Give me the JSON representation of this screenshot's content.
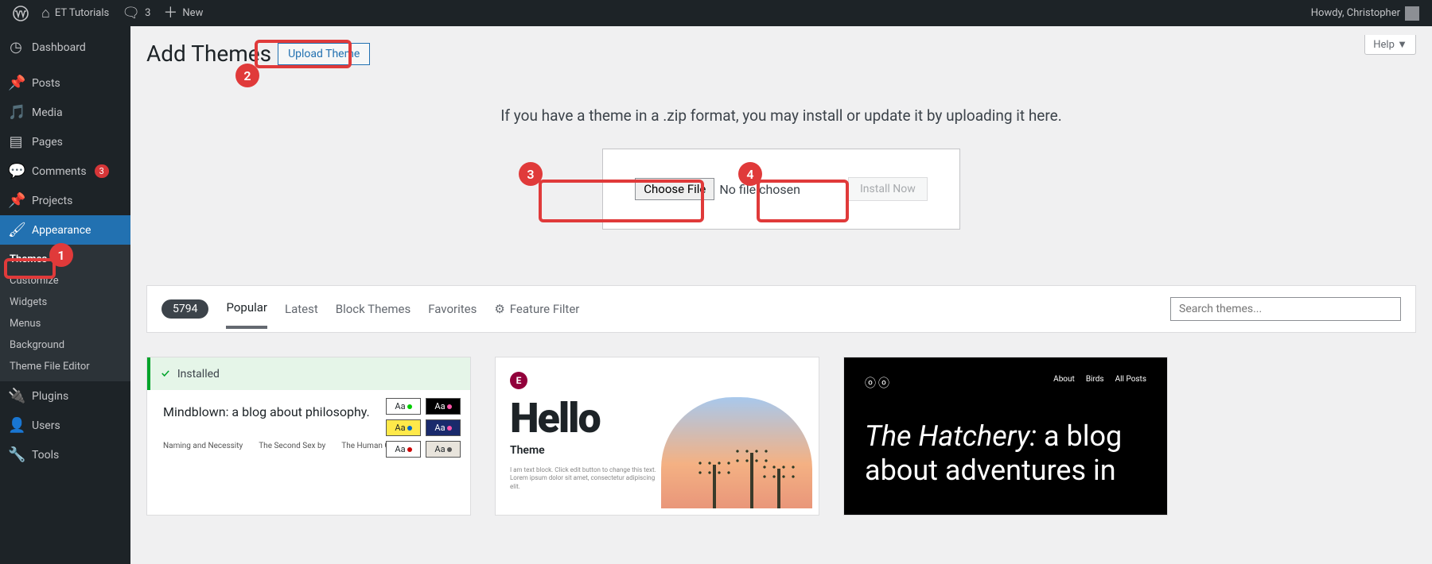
{
  "adminbar": {
    "site_name": "ET Tutorials",
    "comments_count": "3",
    "new_label": "New",
    "howdy": "Howdy, Christopher"
  },
  "sidebar": {
    "dashboard": "Dashboard",
    "posts": "Posts",
    "media": "Media",
    "pages": "Pages",
    "comments": "Comments",
    "comments_badge": "3",
    "projects": "Projects",
    "appearance": "Appearance",
    "appearance_sub": {
      "themes": "Themes",
      "customize": "Customize",
      "widgets": "Widgets",
      "menus": "Menus",
      "background": "Background",
      "editor": "Theme File Editor"
    },
    "plugins": "Plugins",
    "users": "Users",
    "tools": "Tools"
  },
  "page": {
    "title": "Add Themes",
    "upload_btn": "Upload Theme",
    "help": "Help",
    "upload_instruction": "If you have a theme in a .zip format, you may install or update it by uploading it here.",
    "choose_file": "Choose File",
    "no_file": "No file chosen",
    "install_now": "Install Now"
  },
  "filters": {
    "count": "5794",
    "popular": "Popular",
    "latest": "Latest",
    "block": "Block Themes",
    "favorites": "Favorites",
    "feature_filter": "Feature Filter",
    "search_placeholder": "Search themes..."
  },
  "themes": {
    "card1": {
      "installed": "Installed",
      "title": "Mindblown: a blog about philosophy.",
      "aa": "Aa",
      "mini1": "Naming and Necessity",
      "mini2": "The Second Sex by",
      "mini3": "The Human Condition"
    },
    "card2": {
      "hello": "Hello",
      "theme": "Theme",
      "lorem": "I am text block. Click edit button to change this text. Lorem ipsum dolor sit amet, consectetur adipiscing elit."
    },
    "card3": {
      "nav_about": "About",
      "nav_birds": "Birds",
      "nav_posts": "All Posts",
      "title_italic": "The Hatchery:",
      "title_rest1": " a blog",
      "title_rest2": "about adventures in"
    }
  },
  "annotations": {
    "n1": "1",
    "n2": "2",
    "n3": "3",
    "n4": "4"
  }
}
